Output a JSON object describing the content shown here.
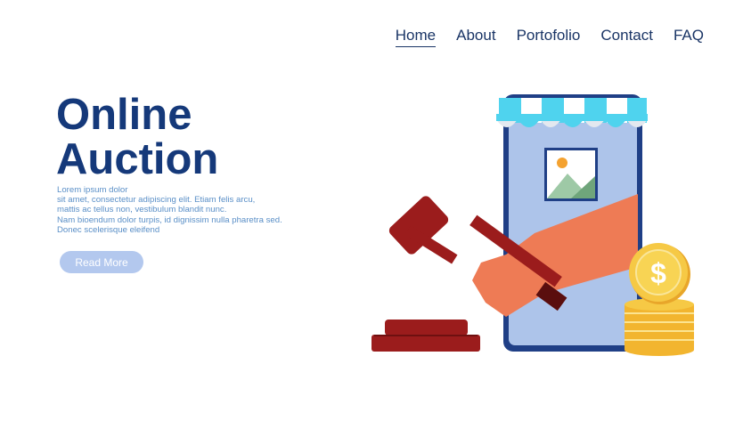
{
  "nav": {
    "items": [
      {
        "label": "Home",
        "active": true
      },
      {
        "label": "About",
        "active": false
      },
      {
        "label": "Portofolio",
        "active": false
      },
      {
        "label": "Contact",
        "active": false
      },
      {
        "label": "FAQ",
        "active": false
      }
    ]
  },
  "hero": {
    "title_line1": "Online",
    "title_line2": "Auction",
    "description_lines": [
      "Lorem ipsum dolor",
      "sit amet, consectetur adipiscing elit. Etiam felis arcu,",
      "mattis ac tellus non, vestibulum blandit nunc.",
      "Nam bioendum dolor turpis, id dignissim nulla pharetra sed.",
      "Donec scelerisque eleifend"
    ],
    "button_label": "Read More"
  },
  "illustration": {
    "coin_symbol": "$"
  },
  "colors": {
    "nav_text": "#1a3566",
    "title": "#15397a",
    "description": "#5a8fc7",
    "button_bg": "#b3c8ee",
    "phone_border": "#1f3f86",
    "phone_screen": "#adc4ea",
    "awning": "#4fd3ee",
    "hand": "#ee7b55",
    "gavel": "#9b1c1c",
    "coin": "#f6c945"
  }
}
